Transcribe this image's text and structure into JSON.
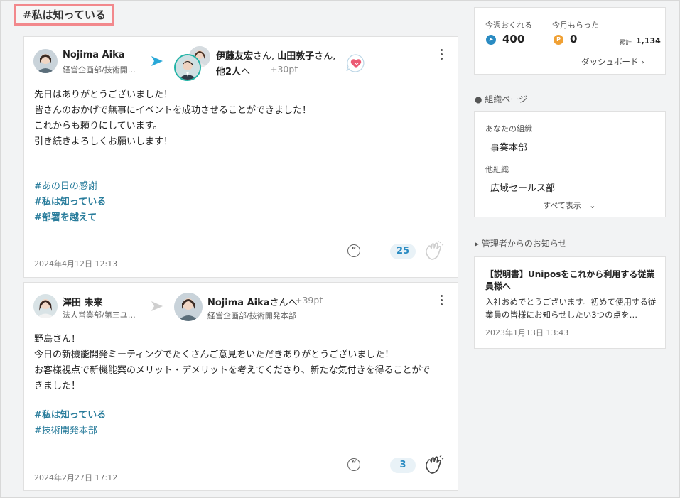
{
  "page_tag": "#私は知っている",
  "posts": [
    {
      "sender_name": "Nojima Aika",
      "sender_dept": "経営企画部/技術開…",
      "recipients_line1_bold1": "伊藤友宏",
      "recipients_line1_san1": "さん, ",
      "recipients_line1_bold2": "山田敦子",
      "recipients_line1_san2": "さん,",
      "recipients_line2_bold": "他2人",
      "recipients_line2_suffix": "へ",
      "points": "+30pt",
      "message": "先日はありがとうございました！\n皆さんのおかげで無事にイベントを成功させることができました！\nこれからも頼りにしています。\n引き続きよろしくお願いします！",
      "tags": [
        "#あの日の感謝",
        "#私は知っている",
        "#部署を越えて"
      ],
      "date": "2024年4月12日 12:13",
      "clap_count": "25"
    },
    {
      "sender_name": "澤田 未来",
      "sender_dept": "法人営業部/第三ユ…",
      "recipient_name": "Nojima Aika",
      "recipient_suffix": "さんへ",
      "points": "+39pt",
      "recipient_dept": "経営企画部/技術開発本部",
      "message": "野島さん！\n今日の新機能開発ミーティングでたくさんご意見をいただきありがとうございました！\nお客様視点で新機能案のメリット・デメリットを考えてくださり、新たな気付きを得ることがで\nきました！",
      "tags": [
        "#私は知っている",
        "#技術開発本部"
      ],
      "date": "2024年2月27日 17:12",
      "clap_count": "3"
    }
  ],
  "points_box": {
    "sent_label": "今週おくれる",
    "sent_value": "400",
    "received_label": "今月もらった",
    "received_value": "0",
    "total_label": "累計",
    "total_value": "1,134",
    "dashboard_link": "ダッシュボード"
  },
  "org": {
    "header": "組織ページ",
    "your_org_label": "あなたの組織",
    "your_org": "事業本部",
    "other_label": "他組織",
    "other_org": "広域セールス部",
    "show_all": "すべて表示"
  },
  "notice": {
    "header": "管理者からのお知らせ",
    "title": "【説明書】Uniposをこれから利用する従業員様へ",
    "body": "入社おめでとうございます。初めて使用する従業員の皆様にお知らせしたい3つの点を…",
    "date": "2023年1月13日 13:43"
  },
  "colors": {
    "accent_blue": "#2a8bc2",
    "tag_blue": "#2a7d9c",
    "coin_orange": "#f0a033",
    "highlight_border": "#f2888c"
  }
}
